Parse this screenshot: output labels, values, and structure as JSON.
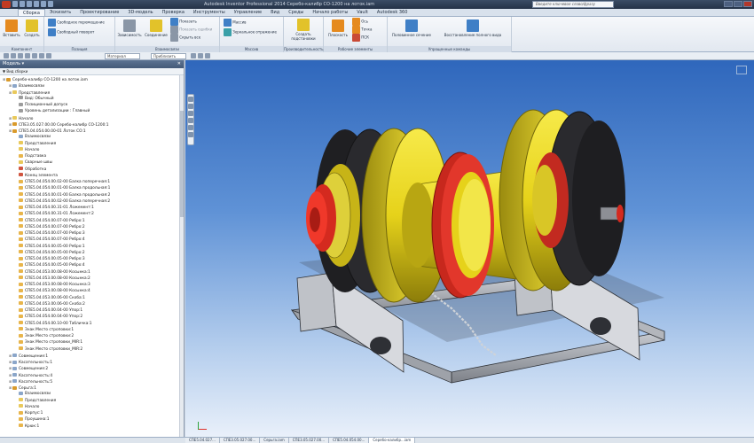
{
  "titlebar": {
    "title": "Autodesk Inventor Professional 2014   Серебо-калибр СО-1200 на лоток.iam",
    "search_placeholder": "Введите ключевое слово/фразу"
  },
  "tabs": [
    "Сборка",
    "Эскизить",
    "Проектирование",
    "3D-модель",
    "Проверка",
    "Инструменты",
    "Управление",
    "Вид",
    "Среды",
    "Начало работы",
    "Vault",
    "Autodesk 360"
  ],
  "ribbon": {
    "components": {
      "title": "Компонент",
      "insert": "Вставить",
      "create": "Создать"
    },
    "position": {
      "title": "Позиция",
      "free_move": "Свободное перемещение",
      "free_rotate": "Свободный поворот"
    },
    "relationships": {
      "title": "Взаимосвязи",
      "constrain": "Зависимость",
      "assemble": "Соединение",
      "show": "Показать",
      "show_sick": "Показать ошибки",
      "hide_all": "Скрыть все"
    },
    "pattern": {
      "title": "Массив",
      "pattern": "Массив",
      "mirror": "Зеркальное отражение"
    },
    "productivity": {
      "title": "Производительность",
      "replace": "Создать подстановки"
    },
    "work_features": {
      "title": "Рабочие элементы",
      "plane": "Плоскость",
      "axis": "Ось",
      "point": "Точка",
      "ucs": "ПСК"
    },
    "simplification": {
      "title": "Упрощенные команды",
      "section": "Половинное сечение",
      "restore": "Восстановление полного вида"
    }
  },
  "toolbar": {
    "material": "Материал",
    "appearance": "Приблизить"
  },
  "browser": {
    "title": "Модель",
    "filter": "Вид сборки",
    "tree": [
      {
        "label": "Серебо-калибр СО-1200 на лоток.iam",
        "icon": "asm",
        "level": 0
      },
      {
        "label": "Взаимосвязи",
        "icon": "rel",
        "level": 1
      },
      {
        "label": "Представления",
        "icon": "folder",
        "level": 1
      },
      {
        "label": "Вид: Обычный",
        "icon": "pt",
        "level": 2
      },
      {
        "label": "Позиционный допуск",
        "icon": "pt",
        "level": 2
      },
      {
        "label": "Уровень детализации : Главный",
        "icon": "pt",
        "level": 2
      },
      {
        "label": "Начало",
        "icon": "folder",
        "level": 1
      },
      {
        "label": "СПЕ3.05.027.00.00 Серебо-калибр СО-1200:1",
        "icon": "asm",
        "level": 1
      },
      {
        "label": "СПЕ5.04.054.00.00-01 Лоток СО:1",
        "icon": "asm",
        "level": 1
      },
      {
        "label": "Взаимосвязи",
        "icon": "rel",
        "level": 2
      },
      {
        "label": "Представления",
        "icon": "folder",
        "level": 2
      },
      {
        "label": "Начало",
        "icon": "folder",
        "level": 2
      },
      {
        "label": "Подставка",
        "icon": "part",
        "level": 2
      },
      {
        "label": "Сварные швы",
        "icon": "folder",
        "level": 2
      },
      {
        "label": "Обработка",
        "icon": "red",
        "level": 2
      },
      {
        "label": "Конец элемента",
        "icon": "red",
        "level": 2
      },
      {
        "label": "СПЕ5.04.054.00.02-00 Балка поперечная:1",
        "icon": "part",
        "level": 2
      },
      {
        "label": "СПЕ5.04.054.00.01-00 Балка продольная:1",
        "icon": "part",
        "level": 2
      },
      {
        "label": "СПЕ5.04.054.00.01-00 Балка продольная:2",
        "icon": "part",
        "level": 2
      },
      {
        "label": "СПЕ5.04.054.00.02-00 Балка поперечная:2",
        "icon": "part",
        "level": 2
      },
      {
        "label": "СПЕ5.04.054.00.31-01 Ложемент:1",
        "icon": "part",
        "level": 2
      },
      {
        "label": "СПЕ5.04.054.00.31-01 Ложемент:2",
        "icon": "part",
        "level": 2
      },
      {
        "label": "СПЕ5.04.054.00.07-00 Ребро:1",
        "icon": "part",
        "level": 2
      },
      {
        "label": "СПЕ5.04.054.00.07-00 Ребро:2",
        "icon": "part",
        "level": 2
      },
      {
        "label": "СПЕ5.04.054.00.07-00 Ребро:3",
        "icon": "part",
        "level": 2
      },
      {
        "label": "СПЕ5.04.054.00.07-00 Ребро:4",
        "icon": "part",
        "level": 2
      },
      {
        "label": "СПЕ5.04.054.00.05-00 Ребро:1",
        "icon": "part",
        "level": 2
      },
      {
        "label": "СПЕ5.04.054.00.05-00 Ребро:2",
        "icon": "part",
        "level": 2
      },
      {
        "label": "СПЕ5.04.054.00.05-00 Ребро:3",
        "icon": "part",
        "level": 2
      },
      {
        "label": "СПЕ5.04.054.00.05-00 Ребро:4",
        "icon": "part",
        "level": 2
      },
      {
        "label": "СПЕ5.04.053.00.08-00 Косынка:1",
        "icon": "part",
        "level": 2
      },
      {
        "label": "СПЕ5.04.053.00.08-00 Косынка:2",
        "icon": "part",
        "level": 2
      },
      {
        "label": "СПЕ5.04.053.00.08-00 Косынка:3",
        "icon": "part",
        "level": 2
      },
      {
        "label": "СПЕ5.04.053.00.08-00 Косынка:4",
        "icon": "part",
        "level": 2
      },
      {
        "label": "СПЕ5.04.053.00.06-00 Скоба:1",
        "icon": "part",
        "level": 2
      },
      {
        "label": "СПЕ5.04.053.00.06-00 Скоба:2",
        "icon": "part",
        "level": 2
      },
      {
        "label": "СПЕ5.04.054.00.04-00 Упор:1",
        "icon": "part",
        "level": 2
      },
      {
        "label": "СПЕ5.04.054.00.04-00 Упор:2",
        "icon": "part",
        "level": 2
      },
      {
        "label": "СПЕ5.04.054.00.10-00 Табличка:1",
        "icon": "part",
        "level": 2
      },
      {
        "label": "Знак Место строповки:1",
        "icon": "part",
        "level": 2
      },
      {
        "label": "Знак Место строповки:2",
        "icon": "part",
        "level": 2
      },
      {
        "label": "Знак Место строповки_MIR:1",
        "icon": "part",
        "level": 2
      },
      {
        "label": "Знак Место строповки_MIR:2",
        "icon": "part",
        "level": 2
      },
      {
        "label": "Совмещение:1",
        "icon": "rel",
        "level": 1
      },
      {
        "label": "Касательность:1",
        "icon": "rel",
        "level": 1
      },
      {
        "label": "Совмещение:2",
        "icon": "rel",
        "level": 1
      },
      {
        "label": "Касательность:4",
        "icon": "rel",
        "level": 1
      },
      {
        "label": "Касательность:5",
        "icon": "rel",
        "level": 1
      },
      {
        "label": "Серьга:1",
        "icon": "asm",
        "level": 1
      },
      {
        "label": "Взаимосвязи",
        "icon": "rel",
        "level": 2
      },
      {
        "label": "Представления",
        "icon": "folder",
        "level": 2
      },
      {
        "label": "Начало",
        "icon": "folder",
        "level": 2
      },
      {
        "label": "Корпус:1",
        "icon": "part",
        "level": 2
      },
      {
        "label": "Проушина:1",
        "icon": "part",
        "level": 2
      },
      {
        "label": "Крюк:1",
        "icon": "part",
        "level": 2
      }
    ]
  },
  "doc_tabs": [
    "СПЕ5.04.027...",
    "СПЕ3.05.027.00...",
    "Серьга.iam",
    "СПЕ3.05.027.00...",
    "СПЕ5.04.054.00...",
    "Серебо-калибр...iam"
  ],
  "colors": {
    "accent": "#3f7fc6",
    "viewport_top": "#2f67bc",
    "model_yellow": "#e6d21a",
    "model_red": "#d42a1f"
  }
}
